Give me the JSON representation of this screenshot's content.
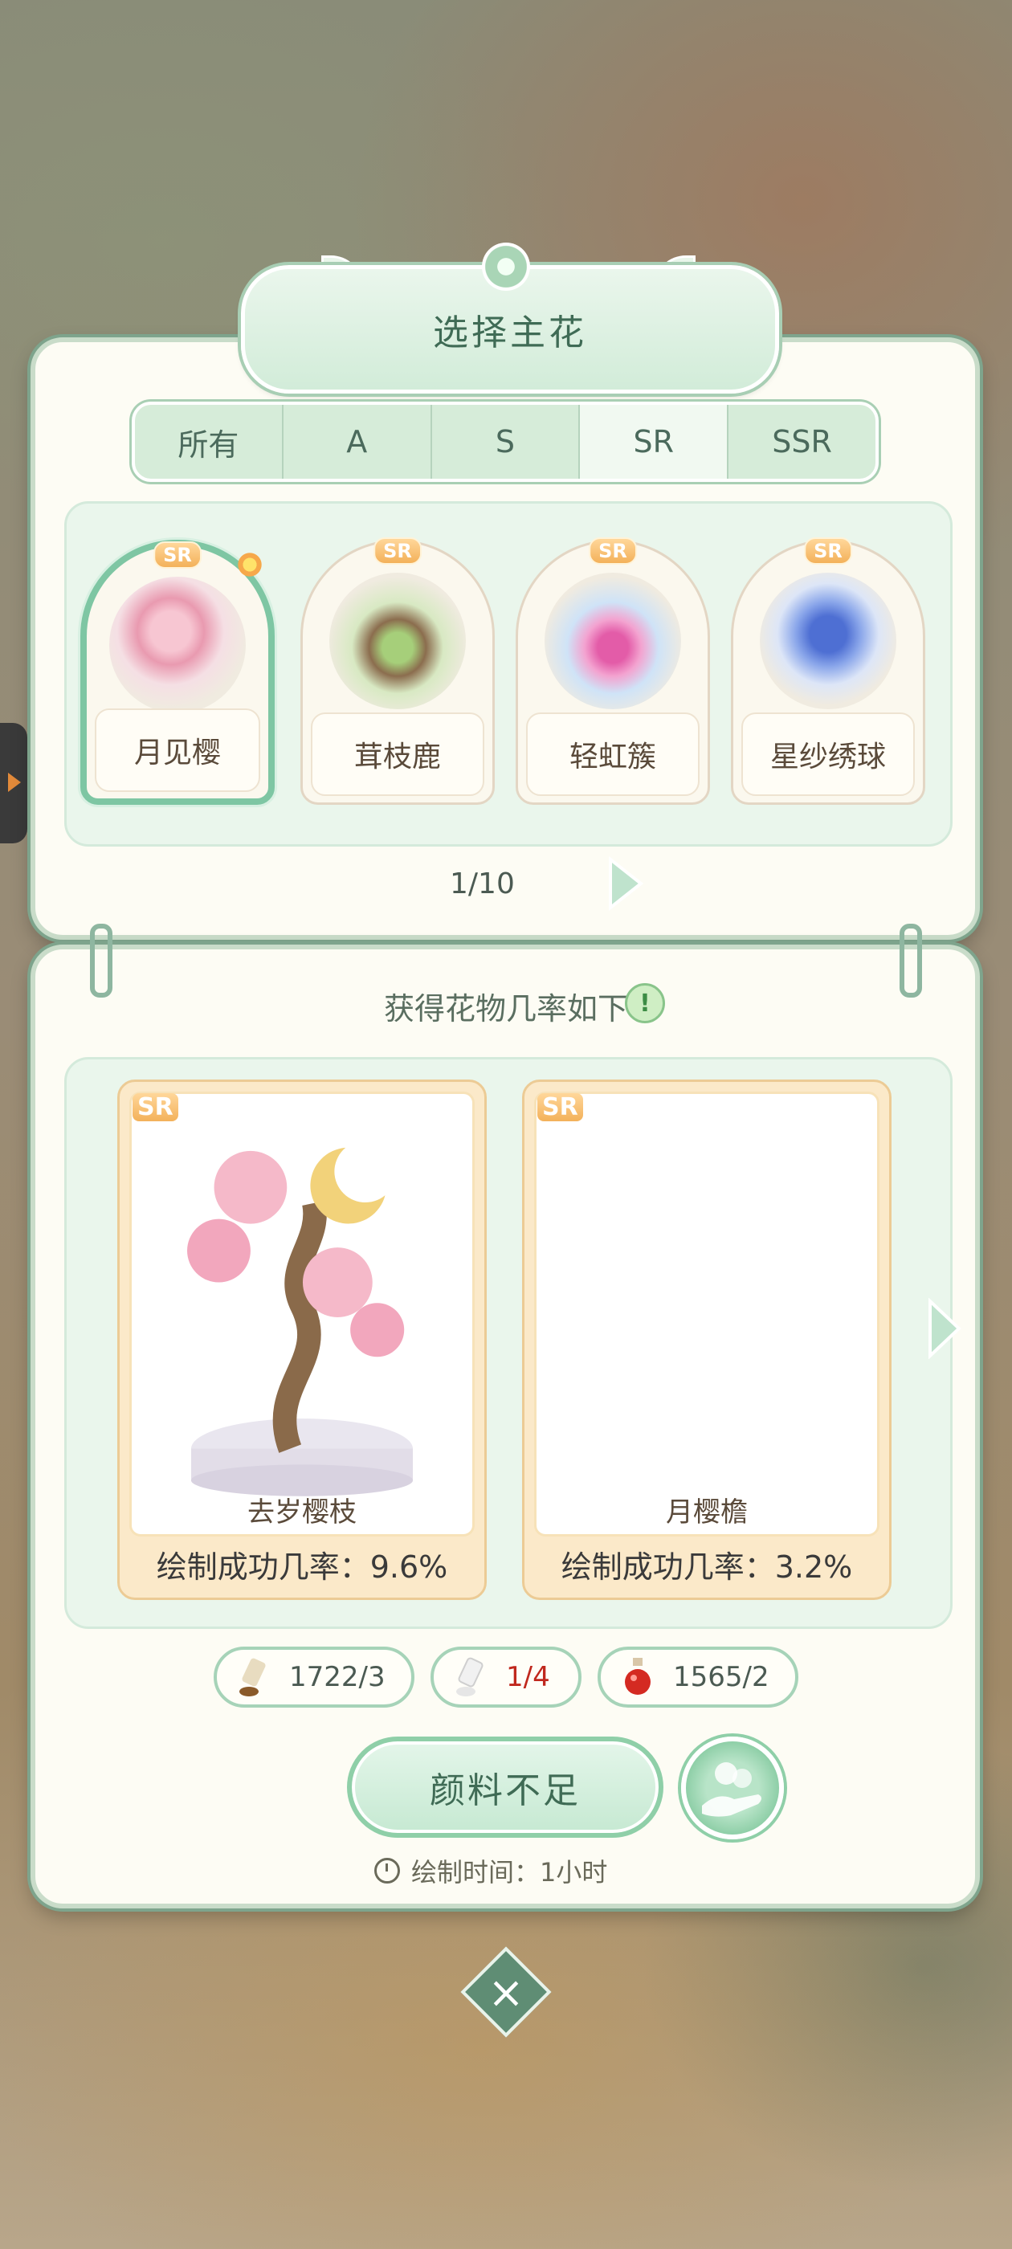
{
  "title": "选择主花",
  "tabs": [
    {
      "label": "所有",
      "active": false
    },
    {
      "label": "A",
      "active": false
    },
    {
      "label": "S",
      "active": false
    },
    {
      "label": "SR",
      "active": true
    },
    {
      "label": "SSR",
      "active": false
    }
  ],
  "flowers": [
    {
      "name": "月见樱",
      "rarity": "SR",
      "selected": true
    },
    {
      "name": "茸枝鹿",
      "rarity": "SR",
      "selected": false
    },
    {
      "name": "轻虹簇",
      "rarity": "SR",
      "selected": false
    },
    {
      "name": "星纱绣球",
      "rarity": "SR",
      "selected": false
    }
  ],
  "pagination": "1/10",
  "rate_section": {
    "heading": "获得花物几率如下",
    "info_icon": "!"
  },
  "rewards": [
    {
      "rarity": "SR",
      "name": "去岁樱枝",
      "rate_label": "绘制成功几率：9.6%"
    },
    {
      "rarity": "SR",
      "name": "月樱檐",
      "rate_label": "绘制成功几率：3.2%"
    }
  ],
  "costs": [
    {
      "icon": "paint-tube-icon",
      "value": "1722/3",
      "insufficient": false
    },
    {
      "icon": "white-paint-tube-icon",
      "value": "1/4",
      "insufficient": true
    },
    {
      "icon": "red-potion-icon",
      "value": "1565/2",
      "insufficient": false
    }
  ],
  "actions": {
    "paint_button": "颜料不足",
    "time_label": "绘制时间：1小时"
  },
  "colors": {
    "accent_green": "#8fcfa8",
    "title_text": "#3f6b55",
    "warning_red": "#c0281e",
    "sr_badge": "#f3b15a"
  }
}
